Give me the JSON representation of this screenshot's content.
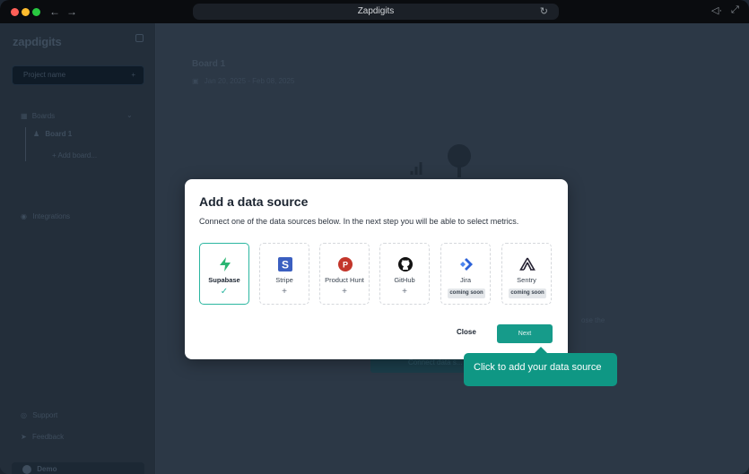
{
  "browser": {
    "title": "Zapdigits"
  },
  "sidebar": {
    "logo": "zapdigits",
    "project_placeholder": "Project name",
    "project_plus": "+",
    "boards_label": "Boards",
    "board_item": "Board 1",
    "add_board": "+ Add board...",
    "integrations": "Integrations",
    "support": "Support",
    "feedback": "Feedback",
    "user": "Demo"
  },
  "main": {
    "board_title": "Board 1",
    "date_range": "Jan 20, 2025 - Feb 08, 2025",
    "side_text": "ose the",
    "button_label": "Connect data s..."
  },
  "modal": {
    "title": "Add a data source",
    "subtitle": "Connect one of the data sources below. In the next step you will be able to select metrics.",
    "sources": [
      {
        "name": "Supabase",
        "status": "✓",
        "icon": "supabase-icon",
        "color": "#2bb673"
      },
      {
        "name": "Stripe",
        "status": "+",
        "icon": "stripe-icon",
        "color": "#3b5fc0"
      },
      {
        "name": "Product Hunt",
        "status": "+",
        "icon": "product-hunt-icon",
        "color": "#c3362b"
      },
      {
        "name": "GitHub",
        "status": "+",
        "icon": "github-icon",
        "color": "#111111"
      },
      {
        "name": "Jira",
        "status": "coming soon",
        "icon": "jira-icon",
        "color": "#2d62d8"
      },
      {
        "name": "Sentry",
        "status": "coming soon",
        "icon": "sentry-icon",
        "color": "#262233"
      }
    ],
    "close_label": "Close",
    "next_label": "Next"
  },
  "tooltip": {
    "text": "Click to add your data source"
  }
}
